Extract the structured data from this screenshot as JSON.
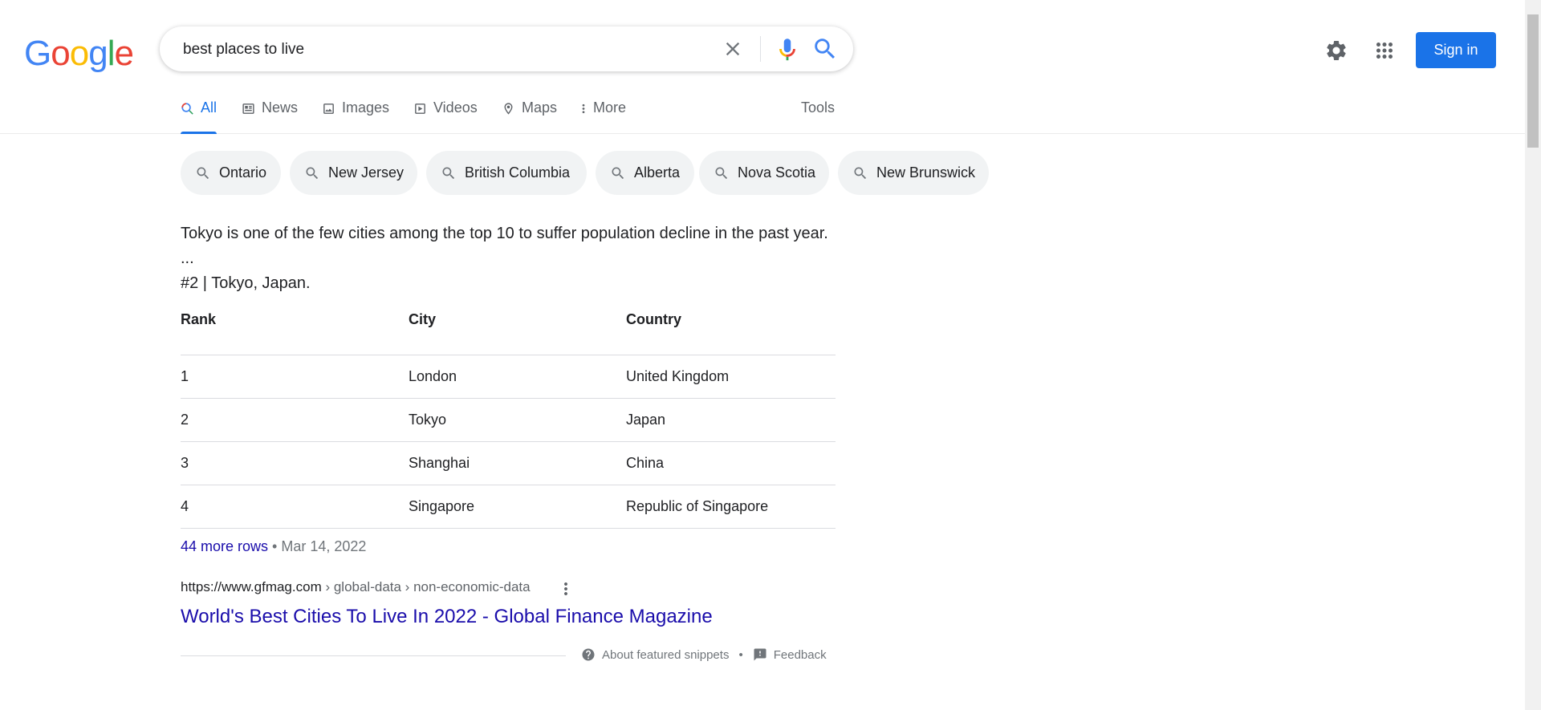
{
  "logo": {
    "letters": [
      "G",
      "o",
      "o",
      "g",
      "l",
      "e"
    ],
    "colors": [
      "#4285f4",
      "#ea4335",
      "#fbbc05",
      "#4285f4",
      "#34a853",
      "#ea4335"
    ]
  },
  "search": {
    "query": "best places to live"
  },
  "header": {
    "signin_label": "Sign in"
  },
  "tabs": [
    {
      "label": "All",
      "icon": "search-icon"
    },
    {
      "label": "News",
      "icon": "news-icon"
    },
    {
      "label": "Images",
      "icon": "image-icon"
    },
    {
      "label": "Videos",
      "icon": "video-icon"
    },
    {
      "label": "Maps",
      "icon": "map-pin-icon"
    },
    {
      "label": "More",
      "icon": "more-vert-icon"
    }
  ],
  "tools_label": "Tools",
  "chips": [
    "Ontario",
    "New Jersey",
    "British Columbia",
    "Alberta",
    "Nova Scotia",
    "New Brunswick"
  ],
  "snippet": {
    "line1": "Tokyo is one of the few cities among the top 10 to suffer population decline in the past year.",
    "line2": "...",
    "line3": "#2 | Tokyo, Japan."
  },
  "table": {
    "headers": [
      "Rank",
      "City",
      "Country"
    ],
    "rows": [
      [
        "1",
        "London",
        "United Kingdom"
      ],
      [
        "2",
        "Tokyo",
        "Japan"
      ],
      [
        "3",
        "Shanghai",
        "China"
      ],
      [
        "4",
        "Singapore",
        "Republic of Singapore"
      ]
    ]
  },
  "more_rows": {
    "link": "44 more rows",
    "sep": " • ",
    "date": "Mar 14, 2022"
  },
  "result": {
    "cite_host": "https://www.gfmag.com",
    "cite_path": " › global-data › non-economic-data",
    "title": "World's Best Cities To Live In 2022 - Global Finance Magazine"
  },
  "footer": {
    "about": "About featured snippets",
    "sep": "•",
    "feedback": "Feedback"
  }
}
